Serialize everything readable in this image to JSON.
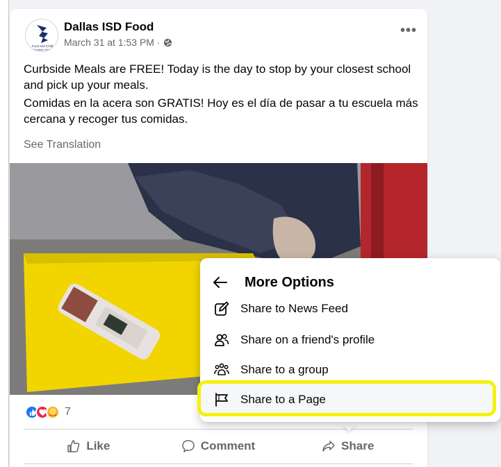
{
  "post": {
    "author": "Dallas ISD Food",
    "timestamp": "March 31 at 1:53 PM ·",
    "avatar_text": "Food and Child Nutrition Services",
    "text_en": "Curbside Meals are FREE! Today is the day to stop by your closest school and pick up your meals.",
    "text_es": "Comidas en la acera son GRATIS! Hoy es el día de pasar a tu escuela más cercana y recoger tus comidas.",
    "see_translation": "See Translation",
    "more_icon": "more-horizontal-icon",
    "reaction_count": "7",
    "reactions": [
      "like-icon",
      "love-icon",
      "care-icon"
    ]
  },
  "actions": {
    "like": "Like",
    "comment": "Comment",
    "share": "Share"
  },
  "menu": {
    "title": "More Options",
    "items": [
      {
        "label": "Share to News Feed",
        "icon": "compose-icon"
      },
      {
        "label": "Share on a friend's profile",
        "icon": "friends-icon"
      },
      {
        "label": "Share to a group",
        "icon": "group-icon"
      },
      {
        "label": "Share to a Page",
        "icon": "flag-icon"
      }
    ]
  },
  "colors": {
    "highlight": "#f4f20c",
    "like_blue": "#1877f2",
    "love_red": "#f02849",
    "care_yellow": "#f7b125"
  }
}
